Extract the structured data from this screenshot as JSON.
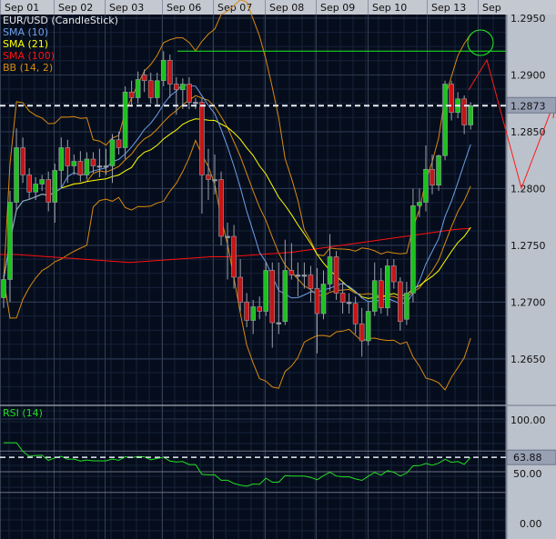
{
  "chart_data": {
    "type": "candlestick",
    "symbol_title": "EUR/USD (CandleStick)",
    "x_labels": [
      "Sep 01",
      "Sep 02",
      "Sep 03",
      "Sep 06",
      "Sep 07",
      "Sep 08",
      "Sep 09",
      "Sep 10",
      "Sep 13",
      "Sep"
    ],
    "candles_per_day": 8,
    "ylim": [
      1.2612,
      1.298
    ],
    "y_ticks": [
      "1.2950",
      "1.2900",
      "1.2850",
      "1.2800",
      "1.2750",
      "1.2700",
      "1.2650"
    ],
    "current_price": "1.2873",
    "ohlc": [
      [
        1.2704,
        1.2724,
        1.2695,
        1.272
      ],
      [
        1.272,
        1.2798,
        1.27,
        1.2788
      ],
      [
        1.2788,
        1.2853,
        1.278,
        1.2836
      ],
      [
        1.2836,
        1.2845,
        1.2805,
        1.2812
      ],
      [
        1.2812,
        1.2818,
        1.279,
        1.2797
      ],
      [
        1.2797,
        1.281,
        1.279,
        1.2804
      ],
      [
        1.2804,
        1.2812,
        1.2798,
        1.2808
      ],
      [
        1.2808,
        1.2815,
        1.278,
        1.2788
      ],
      [
        1.2788,
        1.2822,
        1.277,
        1.2816
      ],
      [
        1.2816,
        1.2845,
        1.28,
        1.2836
      ],
      [
        1.2836,
        1.2843,
        1.2805,
        1.282
      ],
      [
        1.282,
        1.283,
        1.2812,
        1.2824
      ],
      [
        1.2824,
        1.2833,
        1.2806,
        1.2812
      ],
      [
        1.2812,
        1.2832,
        1.2808,
        1.2826
      ],
      [
        1.2826,
        1.2832,
        1.2814,
        1.282
      ],
      [
        1.282,
        1.2835,
        1.281,
        1.282
      ],
      [
        1.282,
        1.2835,
        1.2812,
        1.282
      ],
      [
        1.282,
        1.2848,
        1.2805,
        1.2843
      ],
      [
        1.2843,
        1.285,
        1.283,
        1.2836
      ],
      [
        1.2836,
        1.289,
        1.2826,
        1.2885
      ],
      [
        1.2885,
        1.2895,
        1.2872,
        1.288
      ],
      [
        1.288,
        1.2903,
        1.2875,
        1.2896
      ],
      [
        1.29,
        1.2905,
        1.2885,
        1.2895
      ],
      [
        1.2895,
        1.2902,
        1.2875,
        1.288
      ],
      [
        1.288,
        1.2902,
        1.2872,
        1.2895
      ],
      [
        1.2895,
        1.2921,
        1.289,
        1.2913
      ],
      [
        1.2913,
        1.2918,
        1.288,
        1.2892
      ],
      [
        1.2892,
        1.2898,
        1.2865,
        1.2887
      ],
      [
        1.2887,
        1.2897,
        1.287,
        1.2892
      ],
      [
        1.2892,
        1.2898,
        1.287,
        1.2876
      ],
      [
        1.2876,
        1.288,
        1.287,
        1.2876
      ],
      [
        1.2876,
        1.288,
        1.2778,
        1.2812
      ],
      [
        1.2812,
        1.2835,
        1.279,
        1.2808
      ],
      [
        1.2808,
        1.283,
        1.2795,
        1.2808
      ],
      [
        1.2808,
        1.2815,
        1.275,
        1.2758
      ],
      [
        1.2758,
        1.277,
        1.272,
        1.2758
      ],
      [
        1.2758,
        1.2768,
        1.2712,
        1.2722
      ],
      [
        1.2722,
        1.2738,
        1.2692,
        1.27
      ],
      [
        1.27,
        1.2708,
        1.2678,
        1.2684
      ],
      [
        1.2684,
        1.2702,
        1.2672,
        1.2696
      ],
      [
        1.2696,
        1.2705,
        1.2685,
        1.2692
      ],
      [
        1.2692,
        1.2735,
        1.2688,
        1.2728
      ],
      [
        1.2728,
        1.2735,
        1.266,
        1.2682
      ],
      [
        1.2682,
        1.2735,
        1.2672,
        1.2682
      ],
      [
        1.2683,
        1.2755,
        1.268,
        1.2728
      ],
      [
        1.2728,
        1.2752,
        1.272,
        1.2724
      ],
      [
        1.2724,
        1.2735,
        1.2705,
        1.2724
      ],
      [
        1.2724,
        1.2735,
        1.2712,
        1.2724
      ],
      [
        1.2724,
        1.2732,
        1.27,
        1.2712
      ],
      [
        1.2712,
        1.273,
        1.2655,
        1.269
      ],
      [
        1.269,
        1.2728,
        1.2685,
        1.2716
      ],
      [
        1.2716,
        1.276,
        1.271,
        1.274
      ],
      [
        1.274,
        1.2745,
        1.2702,
        1.2708
      ],
      [
        1.2708,
        1.2718,
        1.269,
        1.27
      ],
      [
        1.27,
        1.2708,
        1.269,
        1.27
      ],
      [
        1.2699,
        1.2705,
        1.2672,
        1.2681
      ],
      [
        1.2681,
        1.2695,
        1.2652,
        1.2666
      ],
      [
        1.2666,
        1.27,
        1.2662,
        1.2692
      ],
      [
        1.2692,
        1.2735,
        1.2688,
        1.2719
      ],
      [
        1.2719,
        1.273,
        1.269,
        1.2695
      ],
      [
        1.2695,
        1.2738,
        1.2688,
        1.2732
      ],
      [
        1.2732,
        1.2738,
        1.2712,
        1.2718
      ],
      [
        1.2718,
        1.2722,
        1.2675,
        1.2683
      ],
      [
        1.2685,
        1.2718,
        1.268,
        1.2708
      ],
      [
        1.2708,
        1.28,
        1.27,
        1.2785
      ],
      [
        1.2785,
        1.28,
        1.2775,
        1.2788
      ],
      [
        1.2788,
        1.2838,
        1.278,
        1.2817
      ],
      [
        1.2817,
        1.283,
        1.2795,
        1.2803
      ],
      [
        1.2803,
        1.283,
        1.2798,
        1.2829
      ],
      [
        1.2829,
        1.2895,
        1.2825,
        1.2892
      ],
      [
        1.2892,
        1.2895,
        1.286,
        1.2867
      ],
      [
        1.2867,
        1.2885,
        1.2862,
        1.2879
      ],
      [
        1.2879,
        1.2882,
        1.2848,
        1.2856
      ],
      [
        1.2856,
        1.2876,
        1.2852,
        1.2873
      ]
    ],
    "indicators": [
      {
        "name": "SMA (10)",
        "color": "#6f9fe8"
      },
      {
        "name": "SMA (21)",
        "color": "#ffff00"
      },
      {
        "name": "SMA (100)",
        "color": "#ff1010"
      },
      {
        "name": "BB (14, 2)",
        "color": "#d98a10"
      }
    ],
    "sma100": [
      1.2742,
      1.2742,
      1.2741,
      1.274,
      1.2739,
      1.2738,
      1.2737,
      1.2736,
      1.2735,
      1.2736,
      1.2737,
      1.2738,
      1.2739,
      1.274,
      1.274,
      1.2741,
      1.2742,
      1.2743,
      1.2744,
      1.2746,
      1.2748,
      1.275,
      1.2752,
      1.2754,
      1.2756,
      1.2758,
      1.276,
      1.2762,
      1.2764,
      1.2765
    ],
    "annotations": {
      "horizontal_line_price": 1.2921,
      "horizontal_line_color": "#22ee22",
      "circle_color": "#22ee22",
      "zigzag_color": "#ff1a1a"
    },
    "rsi": {
      "title": "RSI (14)",
      "period": 14,
      "ylim": [
        0,
        100
      ],
      "y_ticks": [
        "100.00",
        "50.00",
        "0.00"
      ],
      "levels": [
        70,
        50,
        30
      ],
      "current_value": "63.88",
      "color": "#22e022"
    }
  }
}
